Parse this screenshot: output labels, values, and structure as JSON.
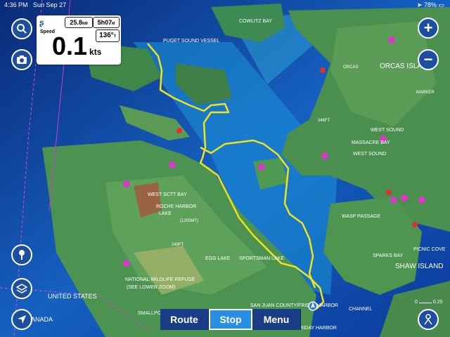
{
  "status_bar": {
    "time": "4:36 PM",
    "date": "Sun Sep 27",
    "battery": "78%"
  },
  "panel": {
    "distance_value": "25.8",
    "distance_unit": "NM",
    "eta_value": "5h07",
    "eta_unit": "M",
    "speed_label": "Speed",
    "speed_value": "0.1",
    "speed_unit": "kts",
    "heading_value": "136°",
    "heading_unit": "T"
  },
  "bottom_bar": {
    "route_label": "Route",
    "stop_label": "Stop",
    "menu_label": "Menu"
  },
  "scale": {
    "left": "0",
    "right": "0.25"
  },
  "map_labels": {
    "cowlitz_bay": "COWLITZ BAY",
    "puget_sound_vessel": "PUGET SOUND VESSEL",
    "orcas_island": "ORCAS ISLAND",
    "orcas": "ORCAS",
    "marker": "MARKER",
    "west_sound": "WEST SOUND",
    "massacre_bay": "MASSACRE BAY",
    "west_sound_2": "WEST SOUND",
    "west_sctt_bay": "WEST SCTT BAY",
    "roche_harbor": "ROCHE HARBOR",
    "lake": "LAKE",
    "wasp_passage": "WASP PASSAGE",
    "shaw_island": "SHAW ISLAND",
    "sparks_bay": "SPARKS BAY",
    "picnic_cove": "PICNIC COVE",
    "sportsman_lake": "SPORTSMAN LAKE",
    "egg_lake": "EGG LAKE",
    "national_wildlife": "NATIONAL WILDLIFE REFUGE",
    "see_lower_zoom": "(SEE LOWER ZOOM)",
    "united_states": "UNITED STATES",
    "canada": "ANADA",
    "san_juan_county": "SAN JUAN COUNTY/FRIDAY HARBOR",
    "friday_harbor": "FRIDAY HARBOR",
    "channel": "CHANNEL",
    "smallpox_bay": "SMALLPOX BAY",
    "depth_346": "346FT",
    "depth_249": "249FT",
    "depth_120": "(1203MT)"
  }
}
